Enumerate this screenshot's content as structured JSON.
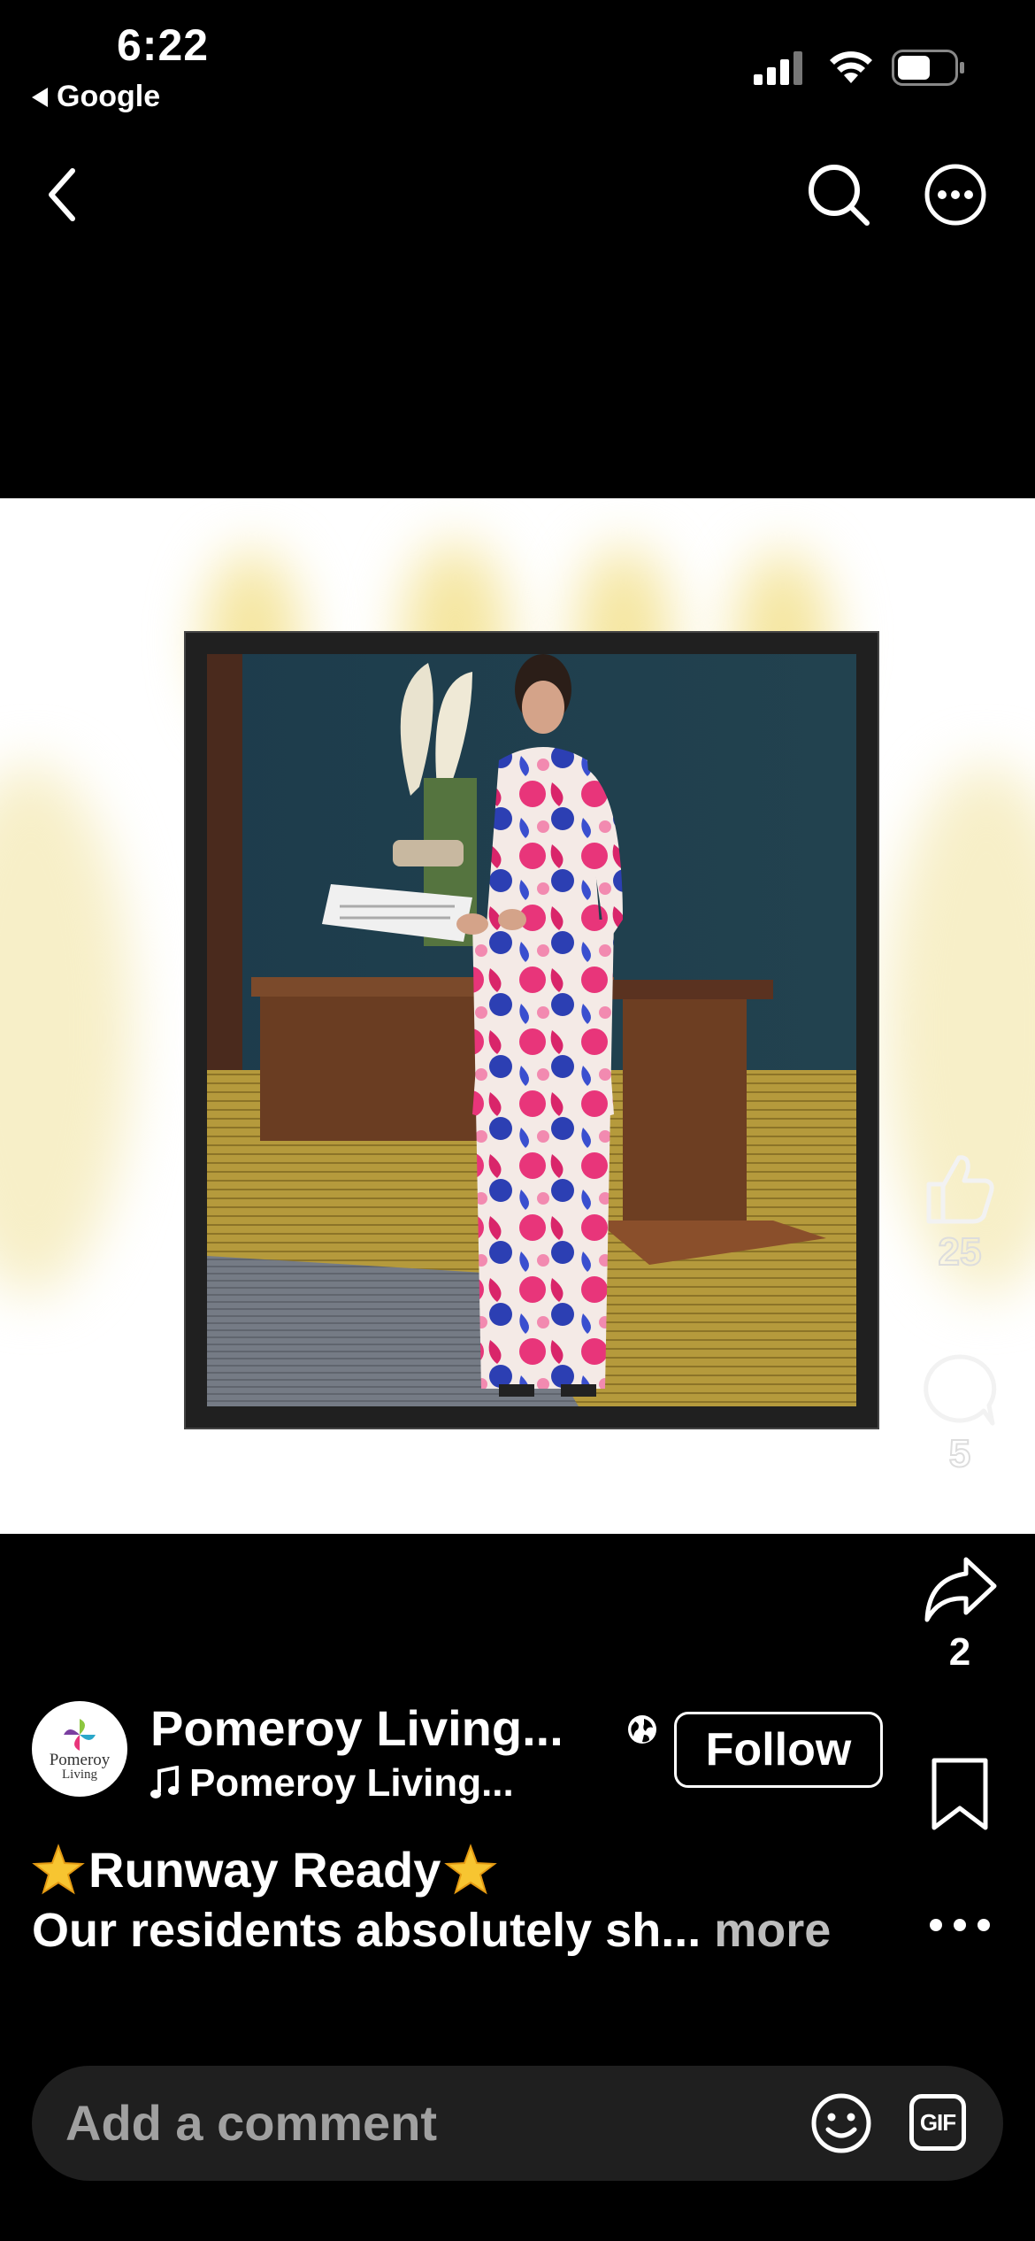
{
  "status_bar": {
    "time": "6:22",
    "back_app": "Google",
    "icons": [
      "signal-icon",
      "wifi-icon",
      "battery-icon"
    ]
  },
  "nav": {
    "back_icon": "chevron-left-icon",
    "search_icon": "search-icon",
    "more_icon": "more-options-icon"
  },
  "actions": {
    "likes": "25",
    "comments": "5",
    "shares": "2"
  },
  "post": {
    "author": "Pomeroy Living...",
    "audio": "Pomeroy Living...",
    "follow_label": "Follow",
    "avatar_text_line1": "Pomeroy",
    "avatar_text_line2": "Living",
    "caption_title": "Runway Ready",
    "caption_text": "Our residents absolutely sh...",
    "more_label": "more"
  },
  "comment": {
    "placeholder": "Add a comment",
    "gif_label": "GIF"
  },
  "colors": {
    "background": "#000000",
    "comment_bar": "#1f1f1f",
    "star": "#f7c531"
  }
}
